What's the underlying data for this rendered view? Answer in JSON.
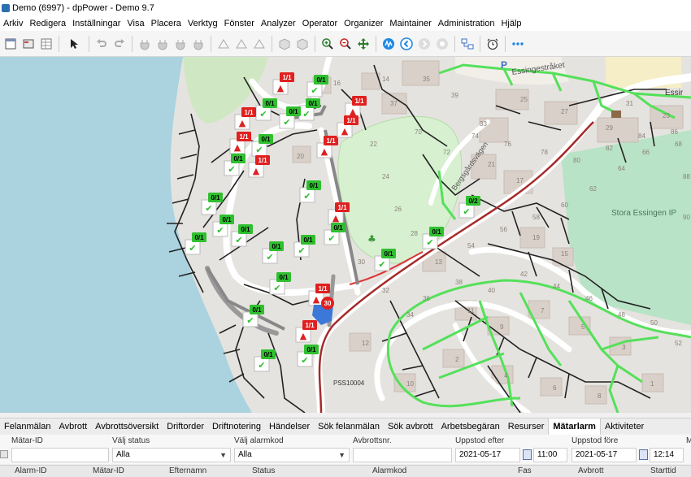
{
  "window": {
    "title": "Demo (6997) - dpPower - Demo 9.7"
  },
  "menu": [
    "Arkiv",
    "Redigera",
    "Inställningar",
    "Visa",
    "Placera",
    "Verktyg",
    "Fönster",
    "Analyzer",
    "Operator",
    "Organizer",
    "Maintainer",
    "Administration",
    "Hjälp"
  ],
  "toolbar_icons": [
    "new-icon",
    "open-icon",
    "table-icon",
    "select-arrow-icon",
    "undo-icon",
    "redo-icon",
    "zoom-in-icon",
    "zoom-out-icon",
    "pan-icon",
    "network-icon",
    "back-icon",
    "forward-icon",
    "stop-icon",
    "layout-icon",
    "alarm-clock-icon",
    "more-icon"
  ],
  "map": {
    "labels": {
      "road_essingestraket": "Essingestråket",
      "road_bergsgarden": "Bergsgårdsvägen",
      "park_stora_essingen": "Stora Essingen IP",
      "parking": "P",
      "station": "PSS10004",
      "cluster_count": "30",
      "corner_label": "Essir"
    },
    "building_numbers": [
      "35",
      "37",
      "39",
      "33",
      "25",
      "27",
      "29",
      "31",
      "23",
      "21",
      "17",
      "19",
      "15",
      "13",
      "11",
      "9",
      "7",
      "5",
      "3",
      "1",
      "2",
      "4",
      "6",
      "8",
      "10",
      "12",
      "14",
      "16",
      "18",
      "20",
      "22",
      "24",
      "26",
      "28",
      "30",
      "32",
      "34",
      "36",
      "38",
      "40",
      "42",
      "44",
      "46",
      "48",
      "50",
      "52",
      "54",
      "56",
      "58",
      "60",
      "62",
      "64",
      "66",
      "68",
      "70",
      "72",
      "74",
      "76",
      "78",
      "80",
      "82",
      "84",
      "86",
      "88",
      "90"
    ],
    "markers": [
      {
        "status": "alarm",
        "label": "1/1"
      },
      {
        "status": "ok",
        "label": "0/1"
      },
      {
        "status": "ok",
        "label": "0/1"
      },
      {
        "status": "alarm",
        "label": "1/1"
      },
      {
        "status": "alarm",
        "label": "1/1"
      },
      {
        "status": "ok",
        "label": "0/1"
      },
      {
        "status": "ok",
        "label": "0/1"
      },
      {
        "status": "alarm",
        "label": "1/1"
      },
      {
        "status": "alarm",
        "label": "1/1"
      },
      {
        "status": "alarm",
        "label": "1/1"
      },
      {
        "status": "ok",
        "label": "0/1"
      },
      {
        "status": "alarm",
        "label": "1/1"
      },
      {
        "status": "ok",
        "label": "0/1"
      },
      {
        "status": "alarm",
        "label": "1/1"
      },
      {
        "status": "ok",
        "label": "0/1"
      },
      {
        "status": "ok",
        "label": "0/1"
      },
      {
        "status": "ok",
        "label": "0/1"
      },
      {
        "status": "ok",
        "label": "0/2"
      },
      {
        "status": "ok",
        "label": "0/1"
      },
      {
        "status": "ok",
        "label": "0/1"
      },
      {
        "status": "ok",
        "label": "0/1"
      },
      {
        "status": "ok",
        "label": "0/1"
      },
      {
        "status": "ok",
        "label": "0/1"
      },
      {
        "status": "ok",
        "label": "0/1"
      },
      {
        "status": "ok",
        "label": "0/1"
      },
      {
        "status": "ok",
        "label": "0/1"
      },
      {
        "status": "ok",
        "label": "0/1"
      },
      {
        "status": "alarm",
        "label": "1/1"
      },
      {
        "status": "alarm",
        "label": "1/1"
      },
      {
        "status": "ok",
        "label": "0/1"
      },
      {
        "status": "ok",
        "label": "0/1"
      }
    ]
  },
  "tabs": [
    "Felanmälan",
    "Avbrott",
    "Avbrottsöversikt",
    "Driftorder",
    "Driftnotering",
    "Händelser",
    "Sök felanmälan",
    "Sök avbrott",
    "Arbetsbegäran",
    "Resurser",
    "Mätarlarm",
    "Aktiviteter"
  ],
  "active_tab": "Mätarlarm",
  "filters": {
    "meter_id": {
      "label": "Mätar-ID",
      "value": ""
    },
    "status": {
      "label": "Välj status",
      "value": "Alla"
    },
    "alarm_code": {
      "label": "Välj alarmkod",
      "value": "Alla"
    },
    "outage_no": {
      "label": "Avbrottsnr.",
      "value": ""
    },
    "occurred_after": {
      "label": "Uppstod efter",
      "date": "2021-05-17",
      "time": "11:00"
    },
    "occurred_before": {
      "label": "Uppstod före",
      "date": "2021-05-17",
      "time": "12:14"
    },
    "cut_label": "M"
  },
  "columns": [
    "Alarm-ID",
    "Mätar-ID",
    "Efternamn",
    "Status",
    "Alarmkod",
    "Fas",
    "Avbrott",
    "Starttid"
  ],
  "colors": {
    "ok": "#2fbf2f",
    "alarm": "#e02020",
    "cable_green": "#55e05a",
    "water": "#aad3df",
    "park": "#c8f0d0",
    "grass": "#cfe8c3"
  }
}
